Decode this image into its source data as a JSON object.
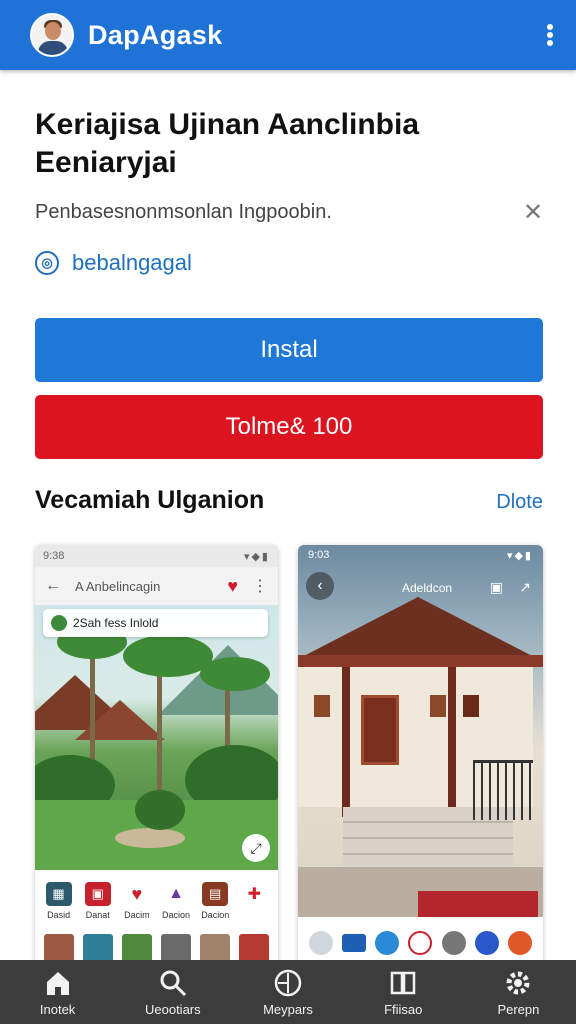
{
  "header": {
    "app_title": "DapAgask",
    "avatar_icon": "user-avatar-icon",
    "menu_icon": "kebab-menu-icon",
    "color": "#1f73d6"
  },
  "listing": {
    "headline": "Keriajisa Ujinan Aanclinbia Eeniaryjai",
    "description": "Penbasesnonmsonlan Ingpoobin.",
    "close_icon": "close-icon",
    "link_text": "bebalngagal"
  },
  "actions": {
    "install_label": "Instal",
    "price_label": "Tolme& 100",
    "install_color": "#1f78d8",
    "price_color": "#dc1420"
  },
  "section": {
    "title": "Vecamiah Ulganion",
    "more_label": "Dlote"
  },
  "screenshot1": {
    "status_time": "9:38",
    "app_title": "A Anbelincagin",
    "pill_text": "2Sah fess Inlold",
    "tiles": [
      {
        "label": "Dasid",
        "color": "#2c5a6b"
      },
      {
        "label": "Danat",
        "color": "#c8202c"
      },
      {
        "label": "Dacim",
        "color": "#c8202c"
      },
      {
        "label": "Dacion",
        "color": "#6a3aa0"
      },
      {
        "label": "Dacion",
        "color": "#8a3a22"
      },
      {
        "label": "",
        "color": "#d0202a"
      }
    ]
  },
  "screenshot2": {
    "status_time": "9:03",
    "label": "Adeldcon"
  },
  "tabbar": {
    "tabs": [
      {
        "label": "Inotek",
        "icon": "home-icon"
      },
      {
        "label": "Ueootiars",
        "icon": "search-icon"
      },
      {
        "label": "Meypars",
        "icon": "compass-icon"
      },
      {
        "label": "Ffiisao",
        "icon": "book-icon"
      },
      {
        "label": "Perepn",
        "icon": "settings-icon"
      }
    ]
  }
}
